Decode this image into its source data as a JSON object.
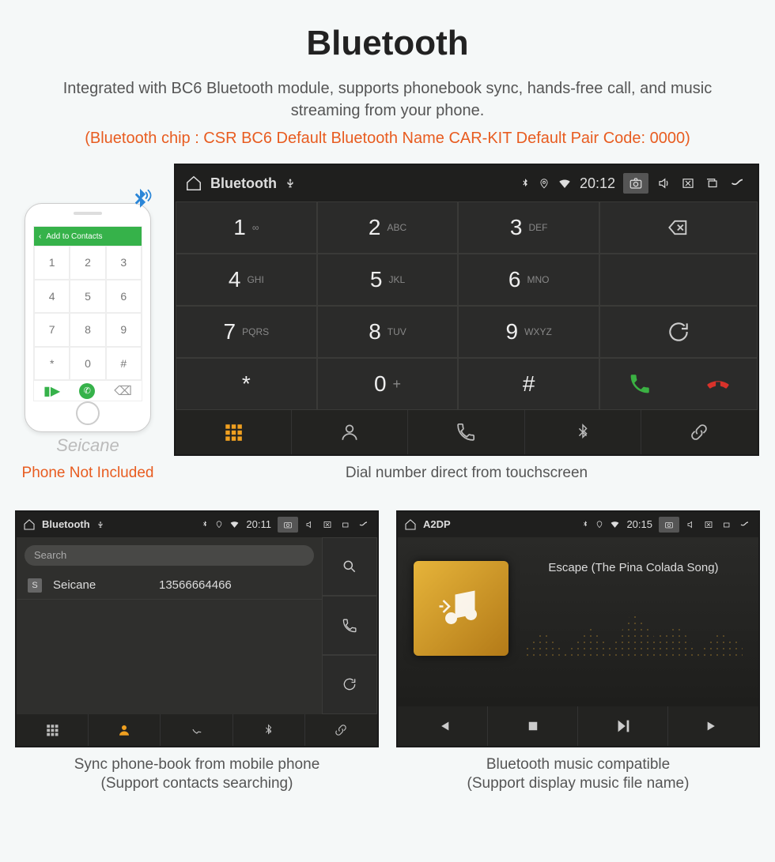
{
  "title": "Bluetooth",
  "description": "Integrated with BC6 Bluetooth module, supports phonebook sync, hands-free call, and music streaming from your phone.",
  "spec_line": "(Bluetooth chip : CSR BC6    Default Bluetooth Name CAR-KIT    Default Pair Code: 0000)",
  "watermark": "Seicane",
  "phone": {
    "app_header": "Add to Contacts",
    "keys": [
      "1",
      "2",
      "3",
      "4",
      "5",
      "6",
      "7",
      "8",
      "9",
      "*",
      "0",
      "#"
    ],
    "caption": "Phone Not Included"
  },
  "dialer": {
    "statusbar": {
      "title": "Bluetooth",
      "time": "20:12"
    },
    "keys": [
      {
        "num": "1",
        "ltr": "∞"
      },
      {
        "num": "2",
        "ltr": "ABC"
      },
      {
        "num": "3",
        "ltr": "DEF"
      },
      {
        "num": "4",
        "ltr": "GHI"
      },
      {
        "num": "5",
        "ltr": "JKL"
      },
      {
        "num": "6",
        "ltr": "MNO"
      },
      {
        "num": "7",
        "ltr": "PQRS"
      },
      {
        "num": "8",
        "ltr": "TUV"
      },
      {
        "num": "9",
        "ltr": "WXYZ"
      },
      {
        "num": "*",
        "ltr": ""
      },
      {
        "num": "0",
        "ltr": "+"
      },
      {
        "num": "#",
        "ltr": ""
      }
    ],
    "caption": "Dial number direct from touchscreen"
  },
  "contacts": {
    "statusbar": {
      "title": "Bluetooth",
      "time": "20:11"
    },
    "search_placeholder": "Search",
    "row": {
      "badge": "S",
      "name": "Seicane",
      "number": "13566664466"
    },
    "caption_l1": "Sync phone-book from mobile phone",
    "caption_l2": "(Support contacts searching)"
  },
  "music": {
    "statusbar": {
      "title": "A2DP",
      "time": "20:15"
    },
    "track": "Escape (The Pina Colada Song)",
    "caption_l1": "Bluetooth music compatible",
    "caption_l2": "(Support display music file name)"
  }
}
